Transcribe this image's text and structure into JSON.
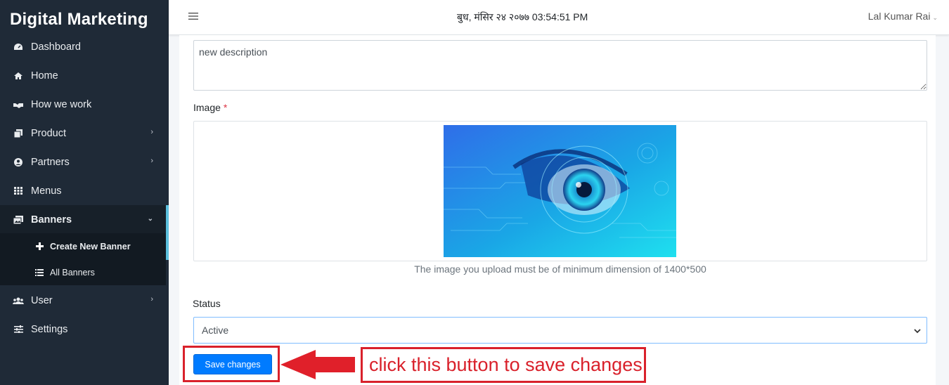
{
  "app": {
    "brand": "Digital Marketing"
  },
  "sidebar": {
    "items": [
      {
        "label": "Dashboard",
        "icon": "dashboard-icon"
      },
      {
        "label": "Home",
        "icon": "home-icon"
      },
      {
        "label": "How we work",
        "icon": "handshake-icon"
      },
      {
        "label": "Product",
        "icon": "copy-icon",
        "expandable": true
      },
      {
        "label": "Partners",
        "icon": "user-circle-icon",
        "expandable": true
      },
      {
        "label": "Menus",
        "icon": "grid-icon"
      },
      {
        "label": "Banners",
        "icon": "images-icon",
        "expanded": true,
        "active": true
      },
      {
        "label": "User",
        "icon": "users-icon",
        "expandable": true
      },
      {
        "label": "Settings",
        "icon": "sliders-icon"
      }
    ],
    "banner_sub": [
      {
        "label": "Create New Banner",
        "icon": "plus-icon",
        "active": true
      },
      {
        "label": "All Banners",
        "icon": "list-icon"
      }
    ]
  },
  "topbar": {
    "datetime": "बुध, मंसिर २४ २०७७ 03:54:51 PM",
    "user": "Lal Kumar Rai"
  },
  "form": {
    "description_value": "new description",
    "image_label": "Image",
    "required_mark": "*",
    "image_hint": "The image you upload must be of minimum dimension of 1400*500",
    "status_label": "Status",
    "status_value": "Active",
    "save_label": "Save changes"
  },
  "annotation": {
    "text": "click this button to save changes",
    "color": "#d9212b"
  },
  "colors": {
    "sidebar_bg": "#1f2a37",
    "accent": "#007bff",
    "active_indicator": "#5bc0de"
  }
}
